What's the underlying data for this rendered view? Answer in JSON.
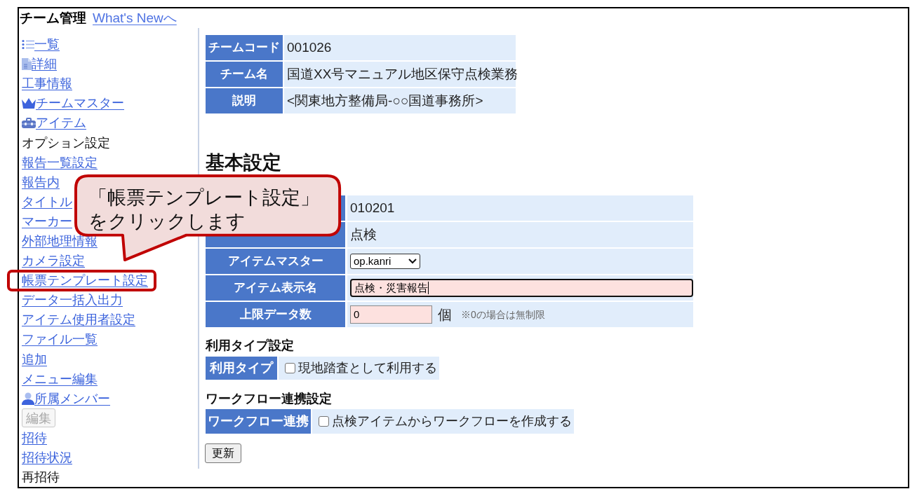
{
  "header": {
    "title": "チーム管理",
    "link": "What's Newへ"
  },
  "sidebar": {
    "items": [
      {
        "kind": "list",
        "label": "一覧",
        "highlighted": false
      },
      {
        "kind": "document",
        "label": "詳細",
        "highlighted": false
      },
      {
        "kind": "link",
        "label": "工事情報",
        "highlighted": false
      },
      {
        "kind": "crown",
        "label": "チームマスター",
        "highlighted": false
      },
      {
        "kind": "toolbox",
        "label": "アイテム",
        "highlighted": false
      },
      {
        "kind": "heading",
        "label": "オプション設定",
        "highlighted": false
      },
      {
        "kind": "link",
        "label": "報告一覧設定",
        "highlighted": false
      },
      {
        "kind": "link",
        "label": "報告内",
        "highlighted": false
      },
      {
        "kind": "link",
        "label": "タイトル",
        "highlighted": false
      },
      {
        "kind": "link",
        "label": "マーカー",
        "highlighted": false
      },
      {
        "kind": "link",
        "label": "外部地理情報",
        "highlighted": false
      },
      {
        "kind": "link",
        "label": "カメラ設定",
        "highlighted": false
      },
      {
        "kind": "link",
        "label": "帳票テンプレート設定",
        "highlighted": true
      },
      {
        "kind": "link",
        "label": "データ一括入出力",
        "highlighted": false
      },
      {
        "kind": "link",
        "label": "アイテム使用者設定",
        "highlighted": false
      },
      {
        "kind": "link",
        "label": "ファイル一覧",
        "highlighted": false
      },
      {
        "kind": "link",
        "label": "追加",
        "highlighted": false
      },
      {
        "kind": "link",
        "label": "メニュー編集",
        "highlighted": false
      },
      {
        "kind": "member",
        "label": "所属メンバー",
        "highlighted": false
      },
      {
        "kind": "button",
        "label": "編集",
        "highlighted": false,
        "disabled": true
      },
      {
        "kind": "link",
        "label": "招待",
        "highlighted": false
      },
      {
        "kind": "link",
        "label": "招待状況",
        "highlighted": false
      },
      {
        "kind": "heading",
        "label": "再招待",
        "highlighted": false
      }
    ]
  },
  "team_info": [
    {
      "label": "チームコード",
      "value": "001026"
    },
    {
      "label": "チーム名",
      "value": "国道XX号マニュアル地区保守点検業務"
    },
    {
      "label": "説明",
      "value": "<関東地方整備局-○○国道事務所>"
    }
  ],
  "basic_settings": {
    "title": "基本設定",
    "rows": [
      {
        "kind": "text",
        "value": "010201"
      },
      {
        "kind": "text",
        "value": "点検"
      },
      {
        "kind": "select",
        "label": "アイテムマスター",
        "value": "op.kanri"
      },
      {
        "kind": "input",
        "label": "アイテム表示名",
        "value": "点検・災害報告",
        "focused": true
      },
      {
        "kind": "number",
        "label": "上限データ数",
        "value": "0",
        "unit": "個",
        "note": "※0の場合は無制限"
      }
    ]
  },
  "usage_type": {
    "title": "利用タイプ設定",
    "label": "利用タイプ",
    "option": {
      "label": "現地踏査として利用する",
      "checked": false
    }
  },
  "workflow": {
    "title": "ワークフロー連携設定",
    "label": "ワークフロー連携",
    "option": {
      "label": "点検アイテムからワークフローを作成する",
      "checked": false
    }
  },
  "submit_button": "更新",
  "callout": {
    "text": "「帳票テンプレート設定」をクリックします"
  }
}
